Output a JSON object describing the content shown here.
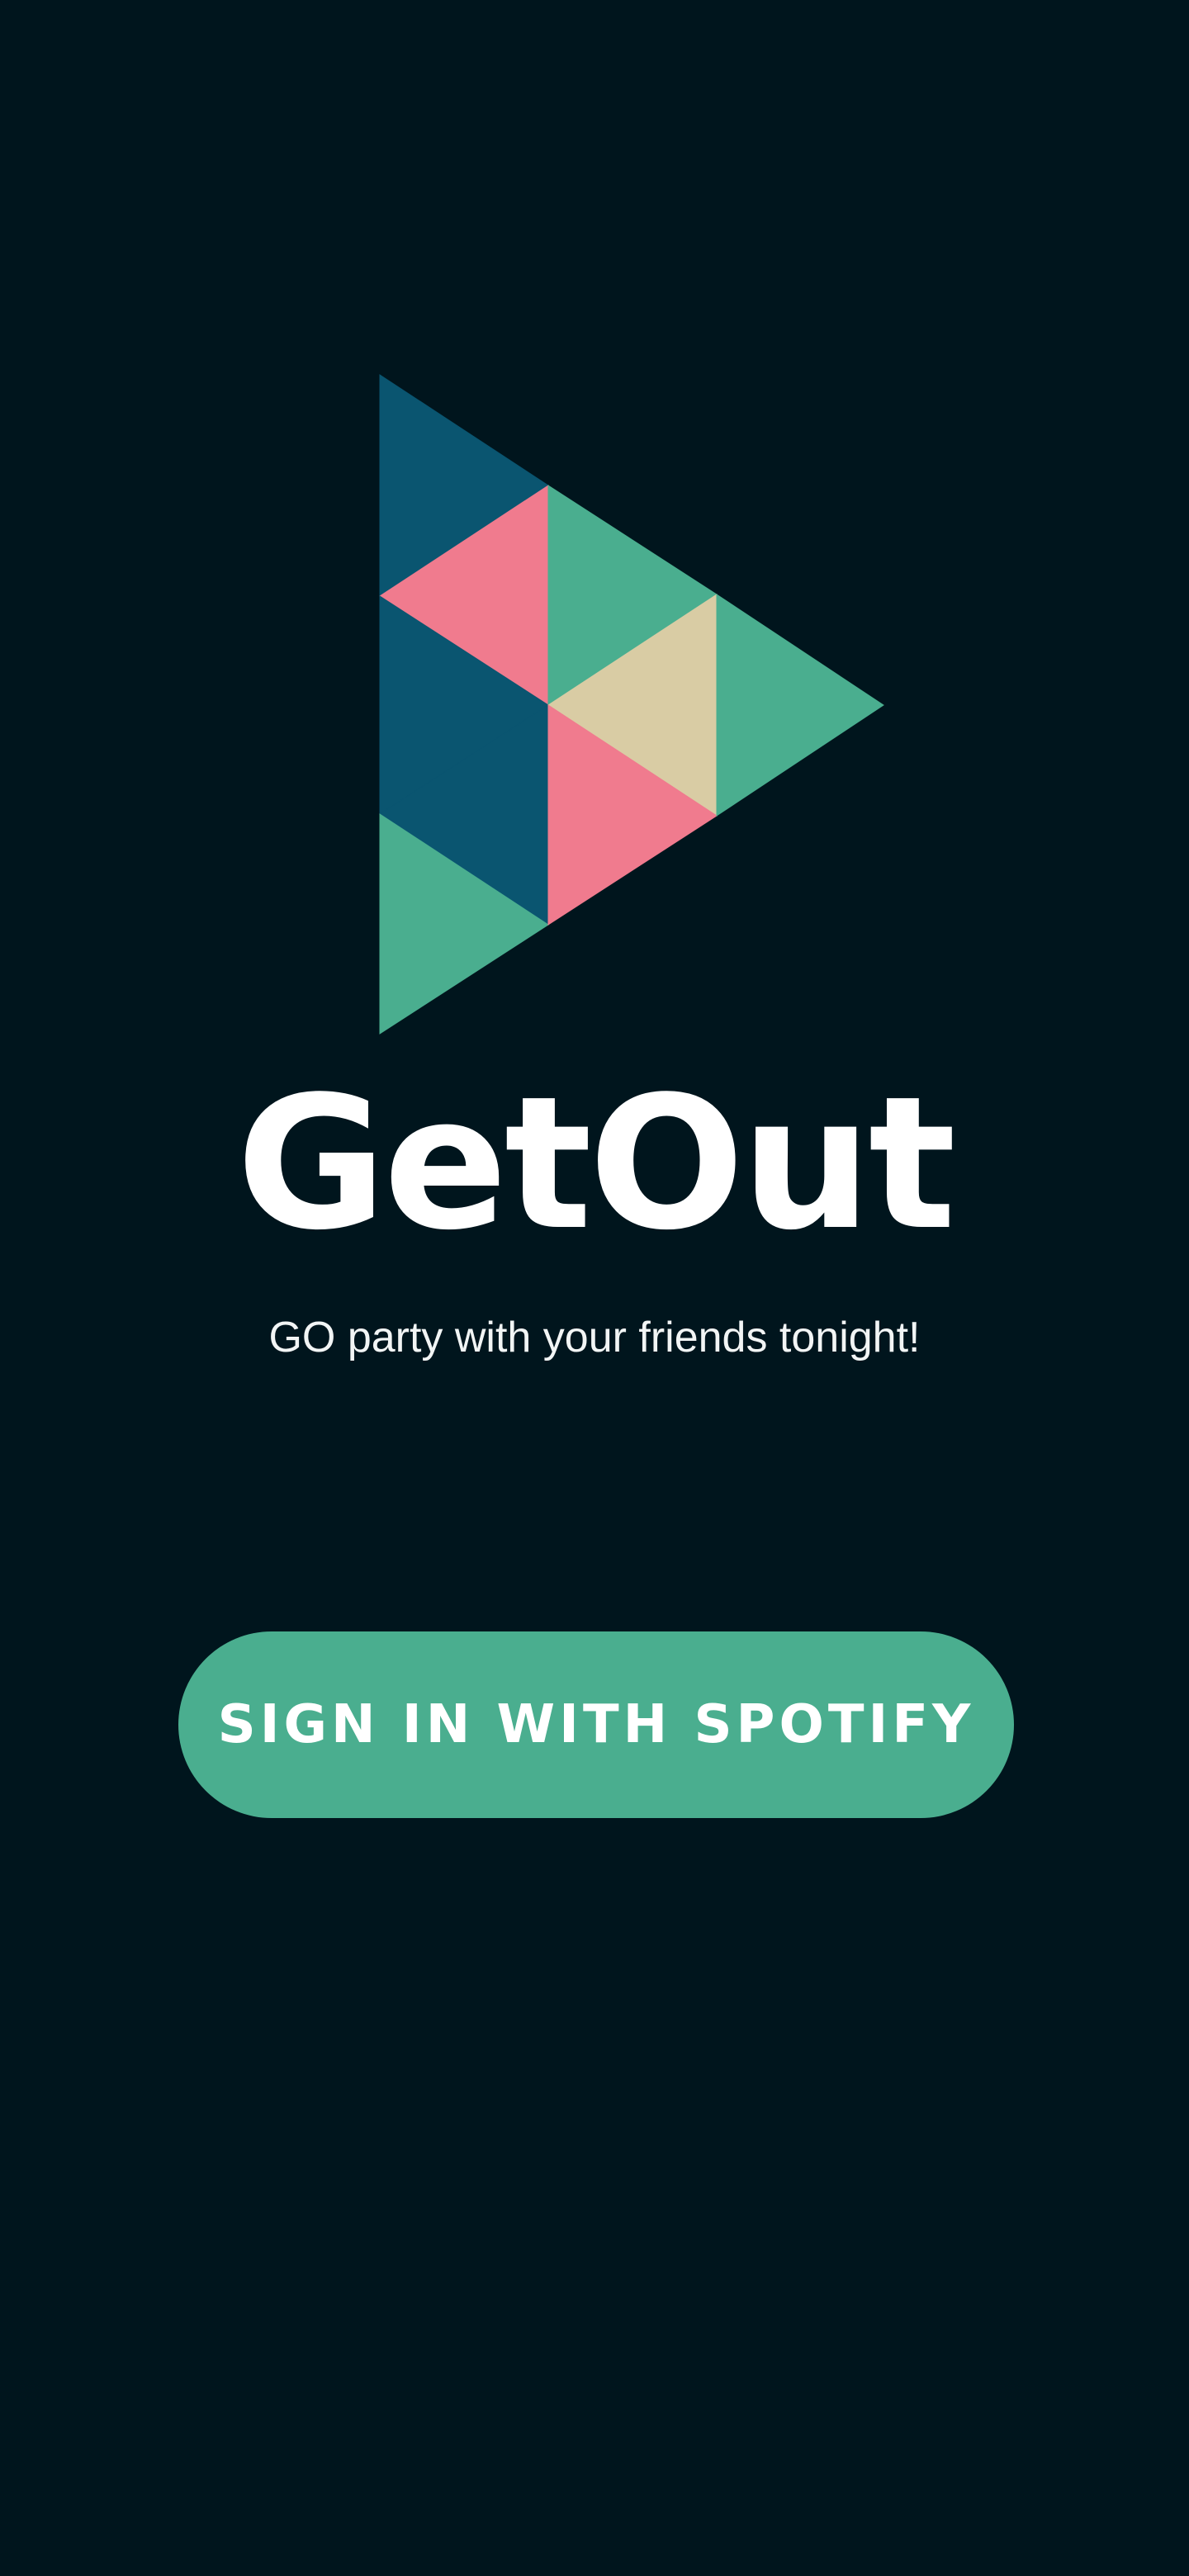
{
  "app": {
    "title": "GetOut",
    "tagline": "GO party with your friends tonight!"
  },
  "signin_button": {
    "label": "SIGN IN WITH SPOTIFY"
  },
  "logo": {
    "icon": "play-triangle-mosaic-logo",
    "colors": {
      "navy": "#0a5570",
      "pink": "#f07b8e",
      "green": "#4aae8f",
      "sand": "#d9cca4"
    }
  },
  "colors": {
    "background": "#00151d",
    "accent": "#4aae8f",
    "text": "#ffffff"
  }
}
